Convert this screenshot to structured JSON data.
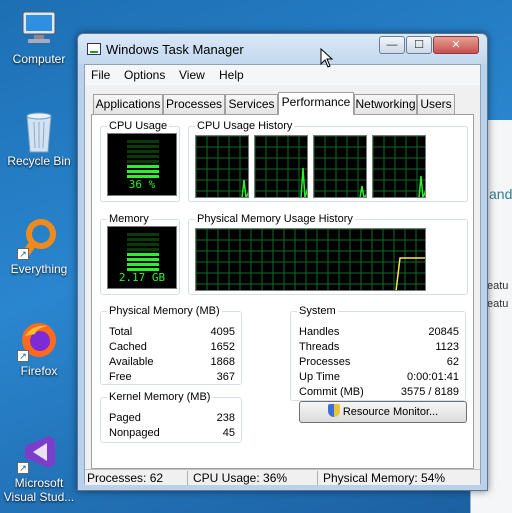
{
  "desktop": {
    "icons": [
      {
        "label": "Computer",
        "icon": "computer-icon"
      },
      {
        "label": "Recycle Bin",
        "icon": "recycle-bin-icon"
      },
      {
        "label": "Everything",
        "icon": "everything-icon"
      },
      {
        "label": "Firefox",
        "icon": "firefox-icon"
      },
      {
        "label": "Microsoft Visual Stud...",
        "icon": "visual-studio-icon"
      }
    ],
    "background_window": {
      "text1": "and",
      "text2": "eatu",
      "text3": "eatu"
    }
  },
  "window": {
    "title": "Windows Task Manager",
    "min_symbol": "—",
    "max_symbol": "☐",
    "close_symbol": "✕"
  },
  "menu": {
    "file": "File",
    "options": "Options",
    "view": "View",
    "help": "Help"
  },
  "tabs": [
    {
      "label": "Applications",
      "active": false
    },
    {
      "label": "Processes",
      "active": false
    },
    {
      "label": "Services",
      "active": false
    },
    {
      "label": "Performance",
      "active": true
    },
    {
      "label": "Networking",
      "active": false
    },
    {
      "label": "Users",
      "active": false
    }
  ],
  "performance": {
    "cpu_usage": {
      "label": "CPU Usage",
      "value": "36 %",
      "percent": 36
    },
    "cpu_history": {
      "label": "CPU Usage History",
      "cores": 4
    },
    "memory": {
      "label": "Memory",
      "value": "2.17 GB",
      "percent": 54
    },
    "memory_history": {
      "label": "Physical Memory Usage History"
    },
    "physical_memory": {
      "label": "Physical Memory (MB)",
      "rows": [
        {
          "key": "Total",
          "value": "4095"
        },
        {
          "key": "Cached",
          "value": "1652"
        },
        {
          "key": "Available",
          "value": "1868"
        },
        {
          "key": "Free",
          "value": "367"
        }
      ]
    },
    "kernel_memory": {
      "label": "Kernel Memory (MB)",
      "rows": [
        {
          "key": "Paged",
          "value": "238"
        },
        {
          "key": "Nonpaged",
          "value": "45"
        }
      ]
    },
    "system": {
      "label": "System",
      "rows": [
        {
          "key": "Handles",
          "value": "20845"
        },
        {
          "key": "Threads",
          "value": "1123"
        },
        {
          "key": "Processes",
          "value": "62"
        },
        {
          "key": "Up Time",
          "value": "0:00:01:41"
        },
        {
          "key": "Commit (MB)",
          "value": "3575 / 8189"
        }
      ]
    },
    "resource_monitor_button": "Resource Monitor..."
  },
  "statusbar": {
    "processes": "Processes: 62",
    "cpu": "CPU Usage: 36%",
    "memory": "Physical Memory: 54%"
  },
  "colors": {
    "graph_green": "#2af22a",
    "graph_bg": "#000000",
    "grid": "#0b6b2b"
  }
}
